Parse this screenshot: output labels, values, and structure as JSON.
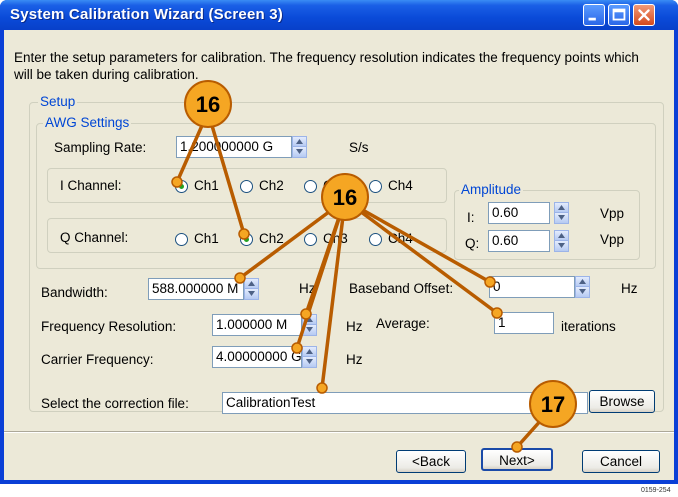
{
  "window": {
    "title": "System Calibration Wizard  (Screen 3)",
    "intro": "Enter the setup parameters for calibration. The frequency resolution indicates the frequency points which will be taken during calibration."
  },
  "setup": {
    "legend": "Setup",
    "awg": {
      "legend": "AWG Settings",
      "sampling_label": "Sampling Rate:",
      "sampling_value": "1.200000000 G",
      "sampling_unit": "S/s",
      "i_label": "I Channel:",
      "q_label": "Q Channel:",
      "channels": [
        "Ch1",
        "Ch2",
        "Ch3",
        "Ch4"
      ],
      "i_selected": "Ch1",
      "q_selected": "Ch2"
    },
    "amplitude": {
      "legend": "Amplitude",
      "i_label": "I:",
      "i_value": "0.60",
      "q_label": "Q:",
      "q_value": "0.60",
      "unit": "Vpp"
    }
  },
  "fields": {
    "bandwidth_label": "Bandwidth:",
    "bandwidth_value": "588.000000 M",
    "bandwidth_unit": "Hz",
    "baseband_label": "Baseband Offset:",
    "baseband_value": "0",
    "baseband_unit": "Hz",
    "freqres_label": "Frequency Resolution:",
    "freqres_value": "1.000000 M",
    "freqres_unit": "Hz",
    "average_label": "Average:",
    "average_value": "1",
    "average_unit": "iterations",
    "carrier_label": "Carrier Frequency:",
    "carrier_value": "4.00000000 G",
    "carrier_unit": "Hz",
    "correction_label": "Select the correction file:",
    "correction_value": "CalibrationTest",
    "browse_label": "Browse"
  },
  "buttons": {
    "back": "<Back",
    "next": "Next>",
    "cancel": "Cancel"
  },
  "callouts": {
    "a": "16",
    "b": "16",
    "c": "17"
  },
  "figure_id": "0159-254",
  "colors": {
    "title_bar": "#0a4ad8",
    "dialog_bg": "#ece9d8",
    "groupbox_legend": "#0046d5",
    "callout_fill": "#f5a623",
    "callout_line": "#b85c00",
    "radio_dot": "#21a121"
  }
}
